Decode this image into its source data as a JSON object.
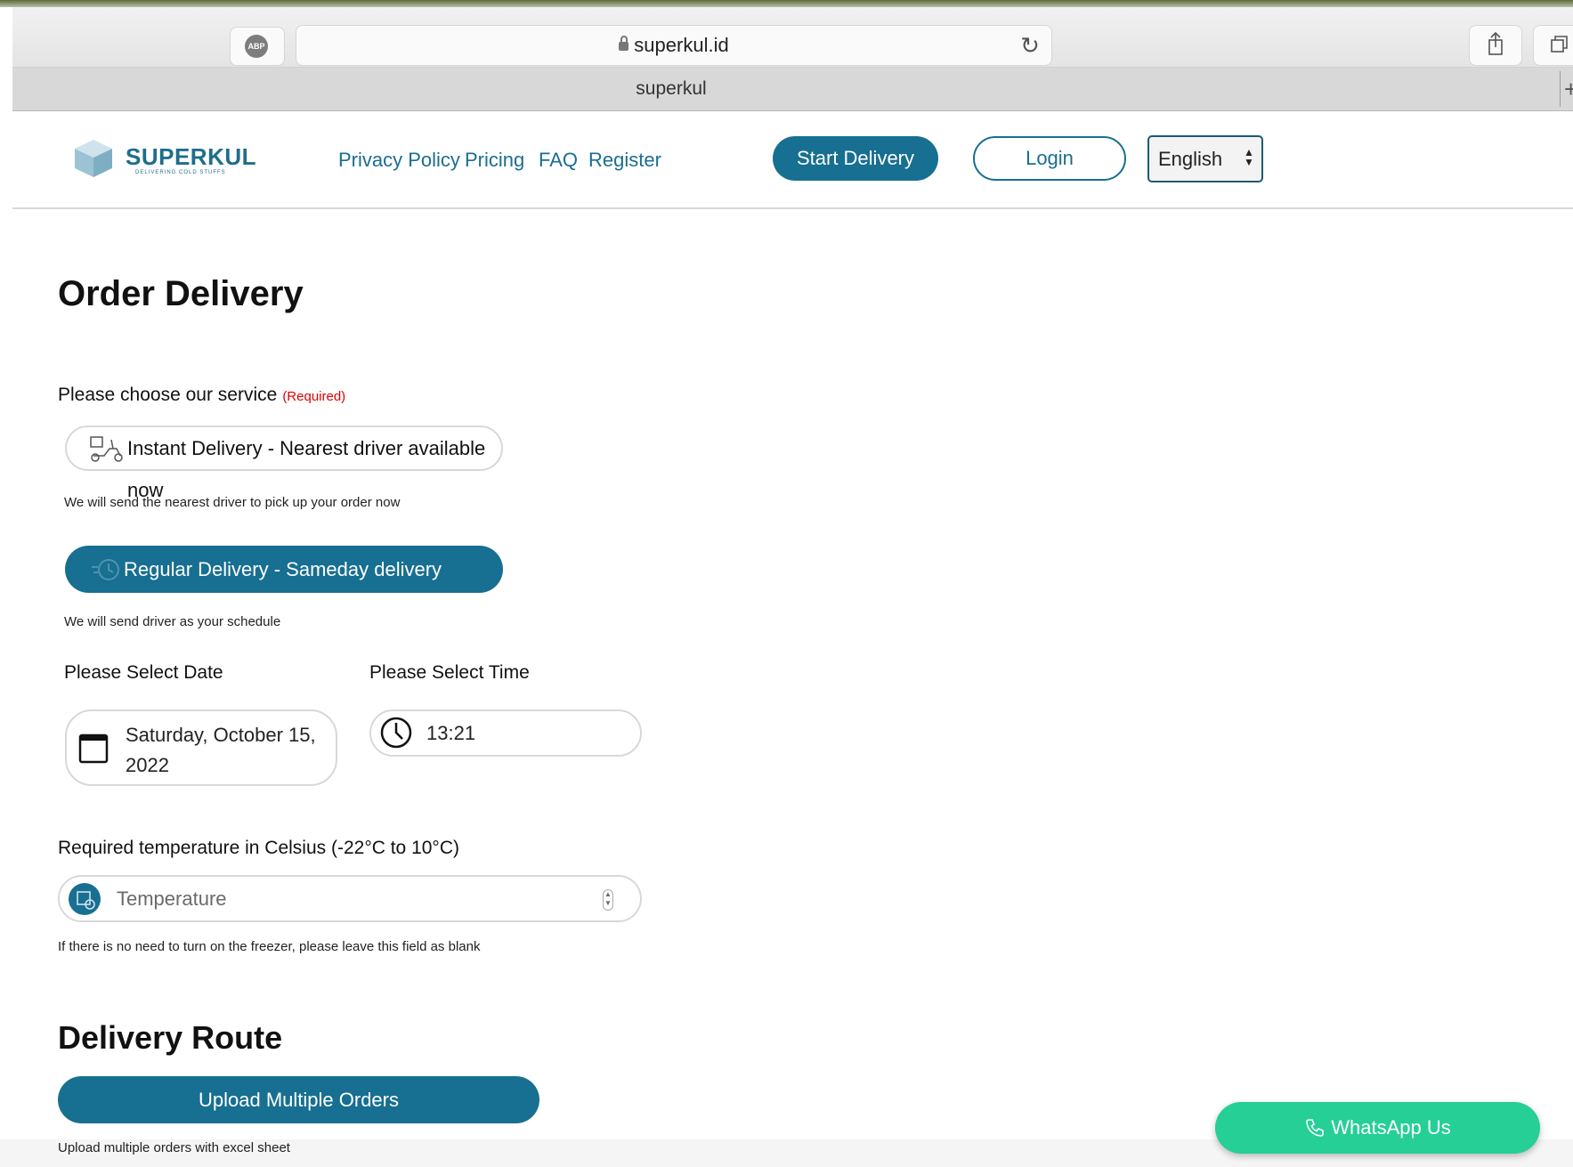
{
  "browser": {
    "url": "superkul.id",
    "tab_title": "superkul",
    "abp_label": "ABP",
    "tab_add": "+"
  },
  "header": {
    "logo_text": "SUPERKUL",
    "logo_tagline": "DELIVERING COLD STUFFS",
    "nav": [
      "Privacy Policy",
      "Pricing",
      "FAQ",
      "Register"
    ],
    "start_delivery": "Start Delivery",
    "login": "Login",
    "language": "English"
  },
  "page": {
    "title": "Order Delivery",
    "service_label": "Please choose our service",
    "required_tag": "(Required)",
    "options": [
      {
        "label": "Instant Delivery - Nearest driver available now",
        "helper": "We will send the nearest driver to pick up your order now",
        "selected": false
      },
      {
        "label": "Regular Delivery - Sameday delivery",
        "helper": "We will send driver as your schedule",
        "selected": true
      }
    ],
    "date_label": "Please Select Date",
    "date_value": "Saturday, October 15, 2022",
    "time_label": "Please Select Time",
    "time_value": "13:21",
    "temp_label": "Required temperature in Celsius (-22°C to 10°C)",
    "temp_placeholder": "Temperature",
    "temp_helper": "If there is no need to turn on the freezer, please leave this field as blank",
    "route_title": "Delivery Route",
    "upload_button": "Upload Multiple Orders",
    "upload_helper": "Upload multiple orders with excel sheet"
  },
  "floating": {
    "whatsapp": "WhatsApp Us"
  },
  "colors": {
    "primary": "#176f91",
    "required": "#e00000",
    "whatsapp": "#25cf95"
  }
}
